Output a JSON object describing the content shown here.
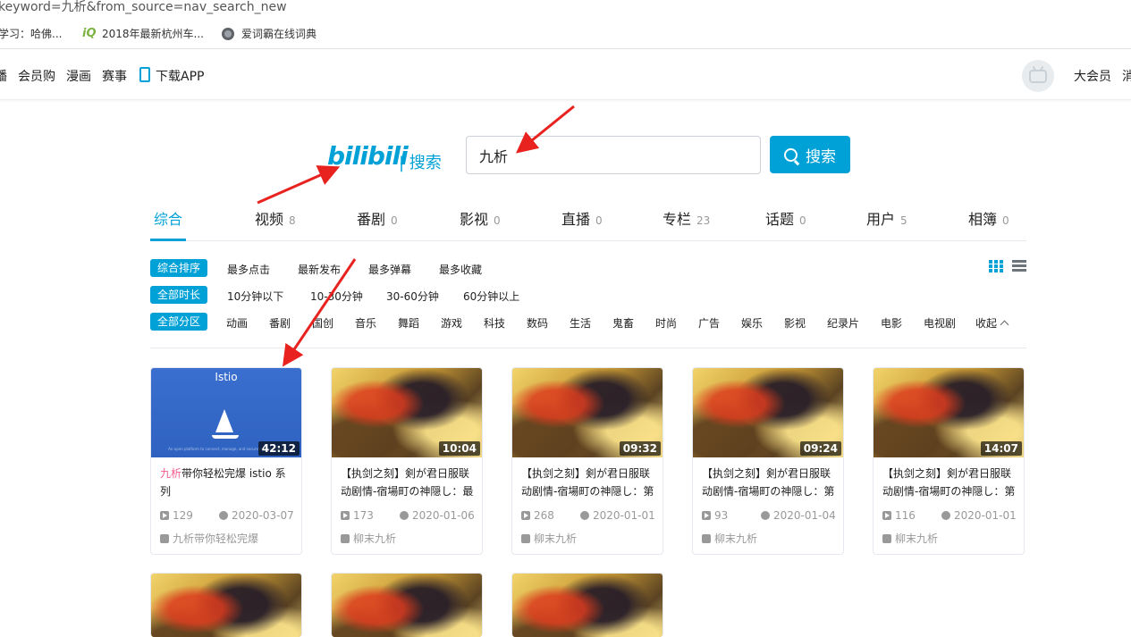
{
  "browser": {
    "url": "keyword=九析&from_source=nav_search_new",
    "bookmarks": [
      {
        "label": "学习：哈佛...",
        "icon": ""
      },
      {
        "label": "2018年最新杭州车...",
        "icon": "iq-icon"
      },
      {
        "label": "爱词霸在线词典",
        "icon": "globe-icon"
      }
    ]
  },
  "header": {
    "nav": [
      "播",
      "会员购",
      "漫画",
      "赛事",
      "下载APP"
    ],
    "right": [
      "大会员",
      "消"
    ]
  },
  "search": {
    "logo": "bilibili",
    "logo_sub": "| 搜索",
    "value": "九析",
    "button": "搜索"
  },
  "tabs": [
    {
      "label": "综合",
      "count": ""
    },
    {
      "label": "视频",
      "count": "8"
    },
    {
      "label": "番剧",
      "count": "0"
    },
    {
      "label": "影视",
      "count": "0"
    },
    {
      "label": "直播",
      "count": "0"
    },
    {
      "label": "专栏",
      "count": "23"
    },
    {
      "label": "话题",
      "count": "0"
    },
    {
      "label": "用户",
      "count": "5"
    },
    {
      "label": "相簿",
      "count": "0"
    }
  ],
  "filters": {
    "sort": {
      "active": "综合排序",
      "options": [
        "最多点击",
        "最新发布",
        "最多弹幕",
        "最多收藏"
      ]
    },
    "duration": {
      "active": "全部时长",
      "options": [
        "10分钟以下",
        "10-30分钟",
        "30-60分钟",
        "60分钟以上"
      ]
    },
    "zone": {
      "active": "全部分区",
      "options": [
        "动画",
        "番剧",
        "国创",
        "音乐",
        "舞蹈",
        "游戏",
        "科技",
        "数码",
        "生活",
        "鬼畜",
        "时尚",
        "广告",
        "娱乐",
        "影视",
        "纪录片",
        "电影",
        "电视剧"
      ],
      "collapse": "收起"
    }
  },
  "videos": [
    {
      "thumb_title": "Istio",
      "thumb_caption": "An open platform to connect, manage, and secure microservices",
      "duration": "42:12",
      "title_highlight": "九析",
      "title_rest": "带你轻松完爆 istio 系列",
      "plays": "129",
      "date": "2020-03-07",
      "uploader": "九析带你轻松完爆"
    },
    {
      "duration": "10:04",
      "title_highlight": "",
      "title_rest": "【执剑之刻】剣が君日服联动剧情-宿場町の神隠し：最",
      "plays": "173",
      "date": "2020-01-06",
      "uploader": "柳末九析"
    },
    {
      "duration": "09:32",
      "title_highlight": "",
      "title_rest": "【执剑之刻】剣が君日服联动剧情-宿場町の神隠し：第",
      "plays": "268",
      "date": "2020-01-01",
      "uploader": "柳末九析"
    },
    {
      "duration": "09:24",
      "title_highlight": "",
      "title_rest": "【执剑之刻】剣が君日服联动剧情-宿場町の神隠し：第",
      "plays": "93",
      "date": "2020-01-04",
      "uploader": "柳末九析"
    },
    {
      "duration": "14:07",
      "title_highlight": "",
      "title_rest": "【执剑之刻】剣が君日服联动剧情-宿場町の神隠し：第",
      "plays": "116",
      "date": "2020-01-01",
      "uploader": "柳末九析"
    }
  ],
  "colors": {
    "accent": "#00a1d6",
    "highlight": "#f25d8e",
    "annotation": "#e8231f"
  }
}
